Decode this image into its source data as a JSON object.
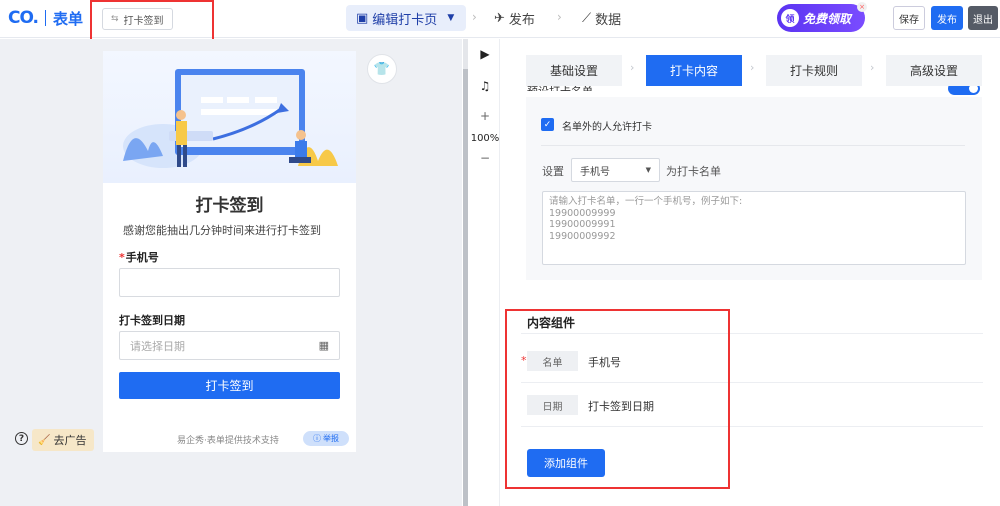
{
  "logo": {
    "mark": "CO.",
    "text": "表单"
  },
  "form_title_chip": {
    "icon": "swap-icon",
    "label": "打卡签到"
  },
  "nav": {
    "edit_label": "编辑打卡页",
    "publish_label": "发布",
    "data_label": "数据"
  },
  "promo": {
    "badge": "领",
    "label": "免费领取"
  },
  "actions": {
    "save": "保存",
    "publish": "发布",
    "exit": "退出"
  },
  "preview": {
    "title": "打卡签到",
    "description": "感谢您能抽出几分钟时间来进行打卡签到",
    "fields": [
      {
        "label": "手机号",
        "required": "*"
      },
      {
        "label": "打卡签到日期",
        "placeholder": "请选择日期"
      }
    ],
    "submit_label": "打卡签到",
    "footer_note": "易企秀·表单提供技术支持",
    "report_label": "举报"
  },
  "ad_remove_label": "去广告",
  "tools": {
    "zoom_level": "100%",
    "zoom_in": "+",
    "zoom_out": "−"
  },
  "steps": [
    {
      "label": "基础设置"
    },
    {
      "label": "打卡内容"
    },
    {
      "label": "打卡规则"
    },
    {
      "label": "高级设置"
    }
  ],
  "content": {
    "cut_label": "预设打卡名单",
    "allow_outside_label": "名单外的人允许打卡",
    "set_label": "设置",
    "select_value": "手机号",
    "as_list_label": "为打卡名单",
    "textarea_text": "请输入打卡名单，一行一个手机号，例子如下:\n19900009999\n19900009991\n19900009992"
  },
  "components": {
    "title": "内容组件",
    "rows": [
      {
        "required": "*",
        "tag": "名单",
        "value": "手机号"
      },
      {
        "required": "",
        "tag": "日期",
        "value": "打卡签到日期"
      }
    ],
    "add_label": "添加组件"
  },
  "colors": {
    "primary": "#1f6cf2",
    "highlight_box": "#e33333"
  }
}
